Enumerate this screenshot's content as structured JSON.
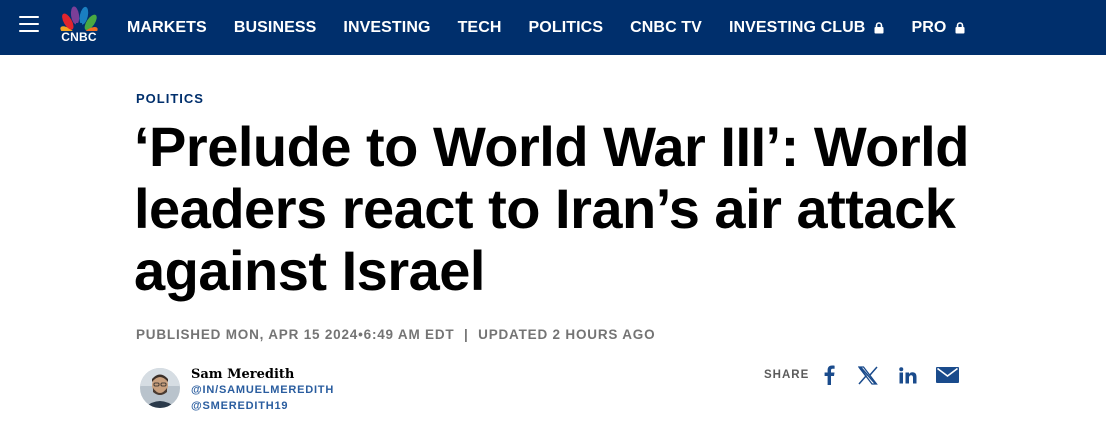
{
  "nav": {
    "brand": "CNBC",
    "items": [
      {
        "label": "MARKETS",
        "locked": false
      },
      {
        "label": "BUSINESS",
        "locked": false
      },
      {
        "label": "INVESTING",
        "locked": false
      },
      {
        "label": "TECH",
        "locked": false
      },
      {
        "label": "POLITICS",
        "locked": false
      },
      {
        "label": "CNBC TV",
        "locked": false
      },
      {
        "label": "INVESTING CLUB",
        "locked": true
      },
      {
        "label": "PRO",
        "locked": true
      }
    ]
  },
  "article": {
    "section": "POLITICS",
    "headline": "‘Prelude to World War III’: World leaders react to Iran’s air attack against Israel",
    "published": "PUBLISHED MON, APR 15 2024•6:49 AM EDT",
    "separator": "|",
    "updated": "UPDATED 2 HOURS AGO"
  },
  "author": {
    "name": "Sam Meredith",
    "link1": "@IN/SAMUELMEREDITH",
    "link2": "@SMEREDITH19"
  },
  "share": {
    "label": "SHARE",
    "icons": [
      "facebook-icon",
      "x-icon",
      "linkedin-icon",
      "email-icon"
    ]
  },
  "colors": {
    "nav_bg": "#002f6c",
    "section": "#002f6c",
    "link": "#2a5d9f",
    "share_icons": "#1a4b8c"
  }
}
